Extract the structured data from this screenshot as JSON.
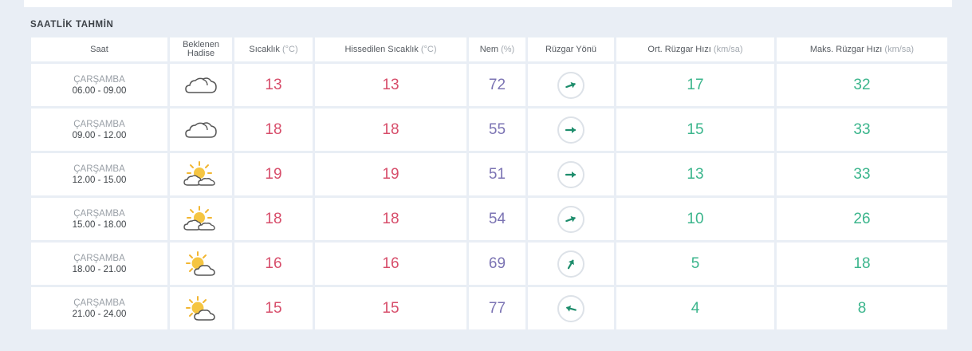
{
  "section_title": "SAATLİK TAHMİN",
  "headers": {
    "time": "Saat",
    "event_line1": "Beklenen",
    "event_line2": "Hadise",
    "temp": "Sıcaklık",
    "temp_unit": "(°C)",
    "feels": "Hissedilen Sıcaklık",
    "feels_unit": "(°C)",
    "humidity": "Nem",
    "humidity_unit": "(%)",
    "wind_dir": "Rüzgar Yönü",
    "avg_wind": "Ort. Rüzgar Hızı",
    "avg_wind_unit": "(km/sa)",
    "max_wind": "Maks. Rüzgar Hızı",
    "max_wind_unit": "(km/sa)"
  },
  "colors": {
    "temperature": "#d74d6a",
    "humidity": "#7b73b3",
    "wind": "#3bb58c",
    "wind_arrow": "#1e8d6c"
  },
  "rows": [
    {
      "day": "ÇARŞAMBA",
      "range": "06.00 - 09.00",
      "icon": "cloud-icon",
      "temp": "13",
      "feels": "13",
      "humidity": "72",
      "wind_dir_deg": 70,
      "avg_wind": "17",
      "max_wind": "32"
    },
    {
      "day": "ÇARŞAMBA",
      "range": "09.00 - 12.00",
      "icon": "cloud-icon",
      "temp": "18",
      "feels": "18",
      "humidity": "55",
      "wind_dir_deg": 90,
      "avg_wind": "15",
      "max_wind": "33"
    },
    {
      "day": "ÇARŞAMBA",
      "range": "12.00 - 15.00",
      "icon": "sun-cloud-icon",
      "temp": "19",
      "feels": "19",
      "humidity": "51",
      "wind_dir_deg": 90,
      "avg_wind": "13",
      "max_wind": "33"
    },
    {
      "day": "ÇARŞAMBA",
      "range": "15.00 - 18.00",
      "icon": "sun-cloud-icon",
      "temp": "18",
      "feels": "18",
      "humidity": "54",
      "wind_dir_deg": 70,
      "avg_wind": "10",
      "max_wind": "26"
    },
    {
      "day": "ÇARŞAMBA",
      "range": "18.00 - 21.00",
      "icon": "partly-sunny-icon",
      "temp": "16",
      "feels": "16",
      "humidity": "69",
      "wind_dir_deg": 30,
      "avg_wind": "5",
      "max_wind": "18"
    },
    {
      "day": "ÇARŞAMBA",
      "range": "21.00 - 24.00",
      "icon": "partly-sunny-icon",
      "temp": "15",
      "feels": "15",
      "humidity": "77",
      "wind_dir_deg": 285,
      "avg_wind": "4",
      "max_wind": "8"
    }
  ]
}
